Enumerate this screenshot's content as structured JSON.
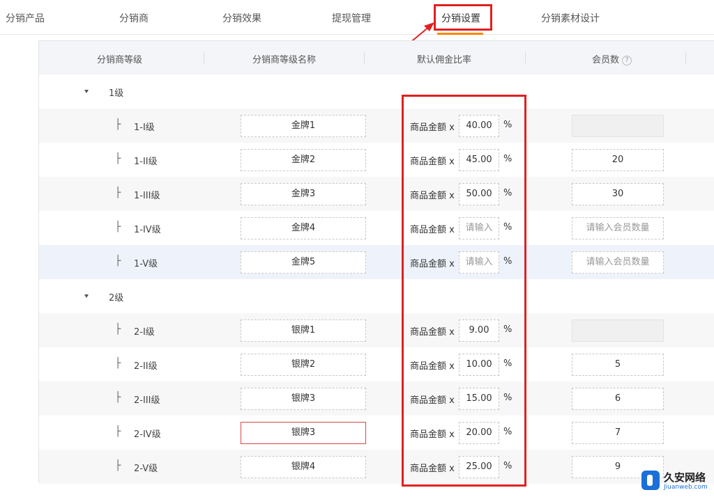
{
  "tabs": [
    {
      "label": "分销产品"
    },
    {
      "label": "分销商"
    },
    {
      "label": "分销效果"
    },
    {
      "label": "提现管理"
    },
    {
      "label": "分销设置"
    },
    {
      "label": "分销素材设计"
    }
  ],
  "active_tab": "分销设置",
  "table": {
    "headers": {
      "level": "分销商等级",
      "name": "分销商等级名称",
      "rate": "默认佣金比率",
      "members": "会员数",
      "help_glyph": "?"
    },
    "rate_prefix": "商品金额 x",
    "rate_suffix": "%",
    "tree_mark": "├",
    "groups": [
      {
        "label": "1级",
        "rows": [
          {
            "level": "1-I级",
            "name": "金牌1",
            "rate": "40.00",
            "members": ""
          },
          {
            "level": "1-II级",
            "name": "金牌2",
            "rate": "45.00",
            "members": "20"
          },
          {
            "level": "1-III级",
            "name": "金牌3",
            "rate": "50.00",
            "members": "30"
          },
          {
            "level": "1-IV级",
            "name": "金牌4",
            "rate_placeholder": "请输入",
            "members_placeholder": "请输入会员数量"
          },
          {
            "level": "1-V级",
            "name": "金牌5",
            "rate_placeholder": "请输入",
            "members_placeholder": "请输入会员数量"
          }
        ]
      },
      {
        "label": "2级",
        "rows": [
          {
            "level": "2-I级",
            "name": "银牌1",
            "rate": "9.00",
            "members": ""
          },
          {
            "level": "2-II级",
            "name": "银牌2",
            "rate": "10.00",
            "members": "5"
          },
          {
            "level": "2-III级",
            "name": "银牌3",
            "rate": "15.00",
            "members": "6"
          },
          {
            "level": "2-IV级",
            "name": "银牌3",
            "rate": "20.00",
            "members": "7"
          },
          {
            "level": "2-V级",
            "name": "银牌4",
            "rate": "25.00",
            "members": "9"
          }
        ]
      }
    ]
  },
  "watermark": {
    "title": "久安网络",
    "subtitle": "Jiuanweb.com"
  },
  "colors": {
    "accent": "#ff8800",
    "highlight_box": "#e02020",
    "error_border": "#d94444",
    "header_bg": "#f3f5f8",
    "stripe_bg": "#f7f7f7",
    "selected_row_bg": "#eef3fb"
  }
}
